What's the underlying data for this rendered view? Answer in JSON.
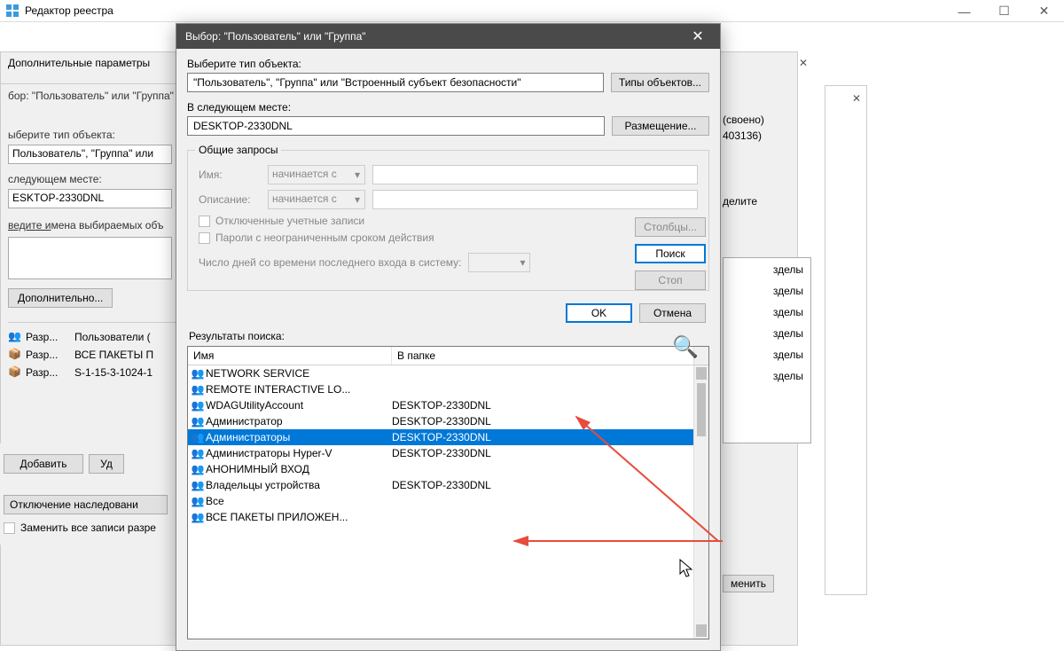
{
  "main_window": {
    "title": "Редактор реестра",
    "controls": {
      "min": "—",
      "max": "☐",
      "close": "✕"
    }
  },
  "bg_advanced": {
    "title": "Дополнительные параметры"
  },
  "bg_select": {
    "title": "бор: \"Пользователь\" или \"Группа\"",
    "label_type": "ыберите тип объекта:",
    "type_val": "Пользователь\", \"Группа\" или",
    "label_loc": "следующем месте:",
    "loc_val": "ESKTOP-2330DNL",
    "label_names": "ведите имена выбираемых объ",
    "btn_additional": "Дополнительно...",
    "perms": [
      {
        "col1": "Разр...",
        "col2": "Пользователи ("
      },
      {
        "col1": "Разр...",
        "col2": "ВСЕ ПАКЕТЫ П"
      },
      {
        "col1": "Разр...",
        "col2": "S-1-15-3-1024-1"
      }
    ],
    "btn_add": "Добавить",
    "btn_remove": "Уд",
    "disable_inherit": "Отключение наследовани",
    "replace_all": "Заменить все записи разре"
  },
  "dialog": {
    "title": "Выбор: \"Пользователь\" или \"Группа\"",
    "label_select_type": "Выберите тип объекта:",
    "type_value": "\"Пользователь\", \"Группа\" или \"Встроенный субъект безопасности\"",
    "btn_object_types": "Типы объектов...",
    "label_location": "В следующем месте:",
    "location_value": "DESKTOP-2330DNL",
    "btn_location": "Размещение...",
    "groupbox_title": "Общие запросы",
    "label_name": "Имя:",
    "label_desc": "Описание:",
    "select_starts": "начинается с",
    "chk_disabled_accounts": "Отключенные учетные записи",
    "chk_nonexpiring": "Пароли с неограниченным сроком действия",
    "label_days": "Число дней со времени последнего входа в систему:",
    "btn_columns": "Столбцы...",
    "btn_search": "Поиск",
    "btn_stop": "Стоп",
    "btn_ok": "OK",
    "btn_cancel": "Отмена",
    "label_results": "Результаты поиска:",
    "col_name": "Имя",
    "col_folder": "В папке",
    "results": [
      {
        "name": "NETWORK SERVICE",
        "folder": ""
      },
      {
        "name": "REMOTE INTERACTIVE LO...",
        "folder": ""
      },
      {
        "name": "WDAGUtilityAccount",
        "folder": "DESKTOP-2330DNL"
      },
      {
        "name": "Администратор",
        "folder": "DESKTOP-2330DNL"
      },
      {
        "name": "Администраторы",
        "folder": "DESKTOP-2330DNL",
        "selected": true
      },
      {
        "name": "Администраторы Hyper-V",
        "folder": "DESKTOP-2330DNL"
      },
      {
        "name": "АНОНИМНЫЙ ВХОД",
        "folder": ""
      },
      {
        "name": "Владельцы устройства",
        "folder": "DESKTOP-2330DNL"
      },
      {
        "name": "Все",
        "folder": ""
      },
      {
        "name": "ВСЕ ПАКЕТЫ ПРИЛОЖЕН...",
        "folder": ""
      }
    ]
  },
  "right_frags": {
    "close_x": "✕",
    "line1": "(своено)",
    "line2": "403136)",
    "line3": "делите",
    "box_items": [
      "зделы",
      "зделы",
      "зделы",
      "зделы",
      "зделы",
      "зделы"
    ],
    "apply": "менить"
  }
}
